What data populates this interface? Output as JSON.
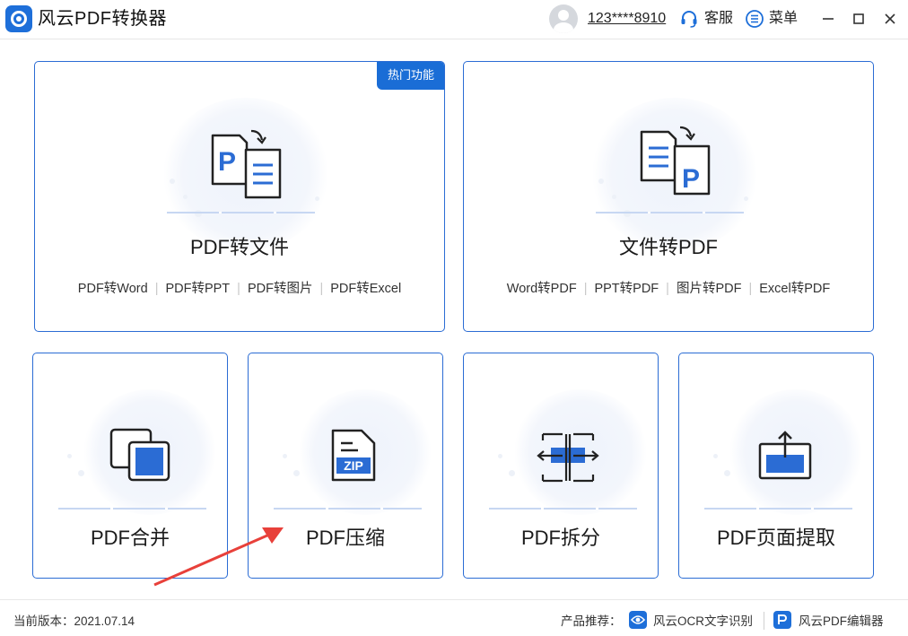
{
  "app": {
    "title": "风云PDF转换器",
    "accent_color": "#1e6fd9"
  },
  "header": {
    "user_name": "123****8910",
    "service_label": "客服",
    "menu_label": "菜单",
    "icons": [
      "avatar-icon",
      "headset-icon",
      "menu-list-icon",
      "minimize-icon",
      "maximize-icon",
      "close-icon"
    ]
  },
  "cards": {
    "pdf_to_file": {
      "title": "PDF转文件",
      "badge": "热门功能",
      "links": [
        "PDF转Word",
        "PDF转PPT",
        "PDF转图片",
        "PDF转Excel"
      ]
    },
    "file_to_pdf": {
      "title": "文件转PDF",
      "links": [
        "Word转PDF",
        "PPT转PDF",
        "图片转PDF",
        "Excel转PDF"
      ]
    },
    "merge": {
      "title": "PDF合并"
    },
    "compress": {
      "title": "PDF压缩",
      "icon_text": "ZIP"
    },
    "split": {
      "title": "PDF拆分"
    },
    "extract": {
      "title": "PDF页面提取"
    }
  },
  "footer": {
    "version": "当前版本：2021.07.14",
    "recommend_label": "产品推荐：",
    "products": [
      "风云OCR文字识别",
      "风云PDF编辑器"
    ]
  }
}
